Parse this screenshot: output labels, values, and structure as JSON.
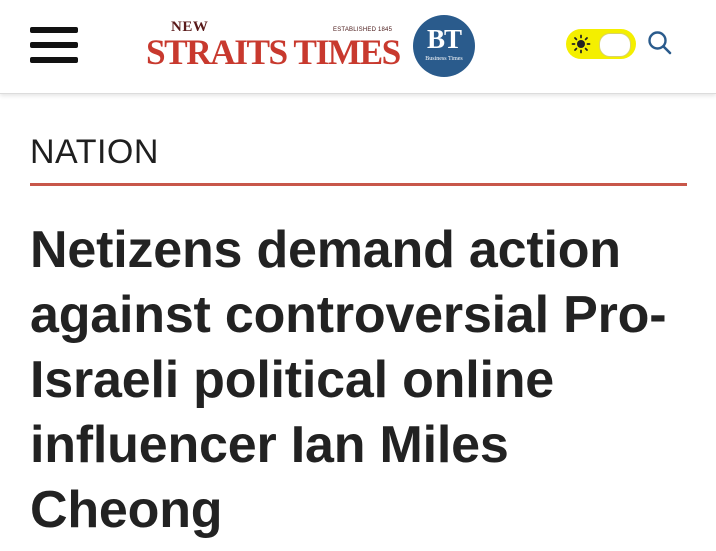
{
  "header": {
    "logo": {
      "new": "NEW",
      "established": "ESTABLISHED 1845",
      "wordmark": "STRAITS TIMES",
      "brand_color": "#c8392e"
    },
    "bt_logo": {
      "letters": "BT",
      "subtitle": "Business Times",
      "color": "#2a5b8c"
    },
    "theme_toggle": {
      "icon": "sun-icon",
      "color": "#f4ef00"
    },
    "search": {
      "icon": "search-icon"
    },
    "menu": {
      "icon": "hamburger-menu-icon"
    }
  },
  "article": {
    "section": "NATION",
    "section_rule_color": "#c8574a",
    "headline": "Netizens demand action against controversial Pro-Israeli political online influencer Ian Miles Cheong"
  }
}
